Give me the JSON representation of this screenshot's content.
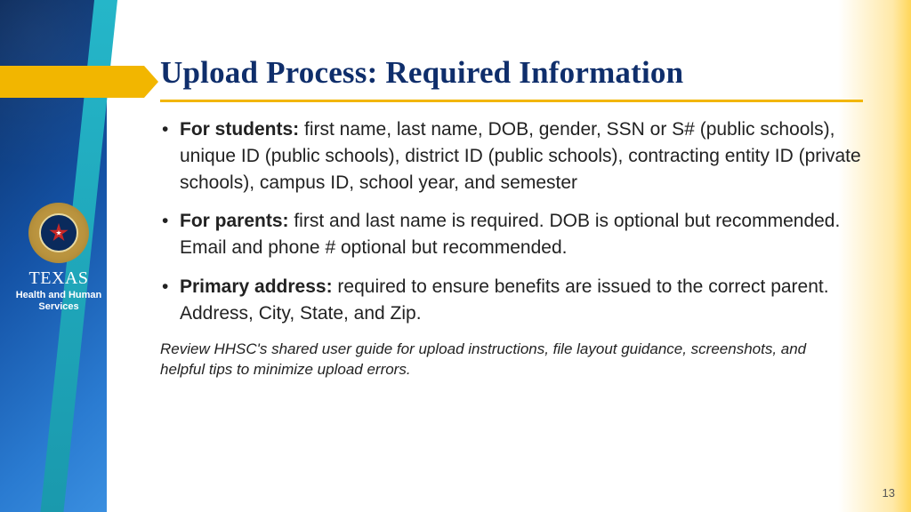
{
  "colors": {
    "title": "#0f2e6b",
    "accent_yellow": "#f2b600",
    "sidebar_blue_dark": "#0a2a5c",
    "sidebar_blue_light": "#2a7bd1",
    "teal": "#25b6c9"
  },
  "logo": {
    "main": "TEXAS",
    "sub_line1": "Health and Human",
    "sub_line2": "Services"
  },
  "title": "Upload Process: Required Information",
  "bullets": [
    {
      "label": "For students:",
      "text": " first name, last name, DOB, gender, SSN or S# (public schools), unique ID (public schools), district ID (public schools), contracting entity ID (private schools), campus ID, school year, and semester"
    },
    {
      "label": "For parents:",
      "text": " first and last name is required. DOB is optional but recommended. Email and phone # optional but recommended."
    },
    {
      "label": "Primary address:",
      "text": " required to ensure benefits are issued to the correct parent. Address, City, State, and Zip."
    }
  ],
  "footnote": "Review HHSC's shared user guide for upload instructions, file layout guidance, screenshots, and helpful tips to minimize upload errors.",
  "page_number": "13"
}
